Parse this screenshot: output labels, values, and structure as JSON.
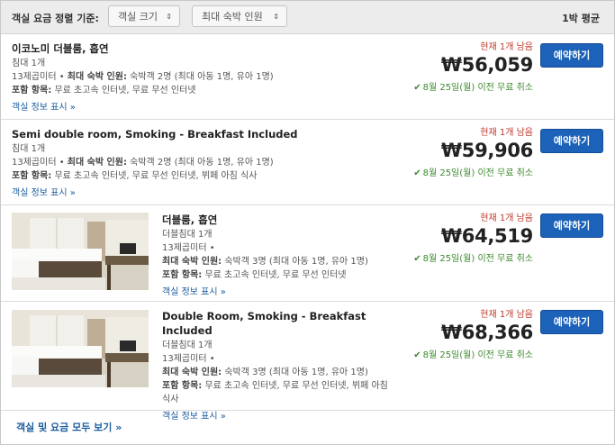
{
  "sort": {
    "label": "객실 요금 정렬 기준:",
    "size_option": "객실 크기",
    "occupancy_option": "최대 숙박 인원",
    "arrow": "⇕",
    "per_night": "1박 평균"
  },
  "rooms": [
    {
      "name": "이코노미 더블룸, 흡연",
      "bed": "침대 1개",
      "size": "13제곱미터 • ",
      "max_label": "최대 숙박 인원:",
      "max_value": " 숙박객 2명 (최대 아동 1명, 유아 1명)",
      "incl_label": "포함 항목:",
      "incl_value": " 무료 초고속 인터넷, 무료 무선 인터넷",
      "more": "객실 정보 표시 »",
      "availability": "현재 1개 남음",
      "price": "₩56,059",
      "cancel": "8월 25일(월) 이전 무료 취소",
      "book": "예약하기"
    },
    {
      "name": "Semi double room, Smoking - Breakfast Included",
      "bed": "침대 1개",
      "size": "13제곱미터 • ",
      "max_label": "최대 숙박 인원:",
      "max_value": " 숙박객 2명 (최대 아동 1명, 유아 1명)",
      "incl_label": "포함 항목:",
      "incl_value": " 무료 초고속 인터넷, 무료 무선 인터넷, 뷔페 아침 식사",
      "more": "객실 정보 표시 »",
      "availability": "현재 1개 남음",
      "price": "₩59,906",
      "cancel": "8월 25일(월) 이전 무료 취소",
      "book": "예약하기"
    },
    {
      "name": "더블룸, 흡연",
      "bed": "더블침대 1개",
      "size": "13제곱미터 •",
      "max_label": "최대 숙박 인원:",
      "max_value": " 숙박객 3명 (최대 아동 1명, 유아 1명)",
      "incl_label": "포함 항목:",
      "incl_value": " 무료 초고속 인터넷, 무료 무선 인터넷",
      "more": "객실 정보 표시 »",
      "availability": "현재 1개 남음",
      "price": "₩64,519",
      "cancel": "8월 25일(월) 이전 무료 취소",
      "book": "예약하기"
    },
    {
      "name": "Double Room, Smoking - Breakfast Included",
      "bed": "더블침대 1개",
      "size": "13제곱미터 •",
      "max_label": "최대 숙박 인원:",
      "max_value": " 숙박객 3명 (최대 아동 1명, 유아 1명)",
      "incl_label": "포함 항목:",
      "incl_value": " 무료 초고속 인터넷, 무료 무선 인터넷, 뷔페 아침 식사",
      "more": "객실 정보 표시 »",
      "availability": "현재 1개 남음",
      "price": "₩68,366",
      "cancel": "8월 25일(월) 이전 무료 취소",
      "book": "예약하기"
    }
  ],
  "icons": {
    "check": "✔"
  },
  "colors": {
    "accent": "#1c62b9",
    "availability": "#c0392b",
    "cancel": "#3d8b2e",
    "link": "#1a5c9e"
  },
  "footer": {
    "show_all": "객실 및 요금 모두 보기 »"
  }
}
